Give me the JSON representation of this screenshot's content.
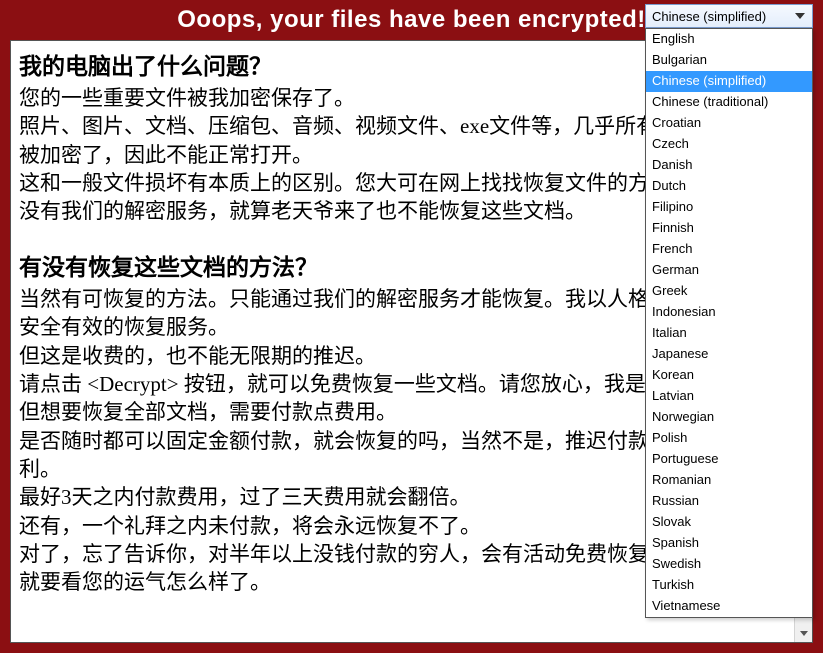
{
  "header": {
    "title": "Ooops, your files have been encrypted!"
  },
  "lang": {
    "selected": "Chinese (simplified)",
    "options": [
      "English",
      "Bulgarian",
      "Chinese (simplified)",
      "Chinese (traditional)",
      "Croatian",
      "Czech",
      "Danish",
      "Dutch",
      "Filipino",
      "Finnish",
      "French",
      "German",
      "Greek",
      "Indonesian",
      "Italian",
      "Japanese",
      "Korean",
      "Latvian",
      "Norwegian",
      "Polish",
      "Portuguese",
      "Romanian",
      "Russian",
      "Slovak",
      "Spanish",
      "Swedish",
      "Turkish",
      "Vietnamese"
    ]
  },
  "body": {
    "h1": "我的电脑出了什么问题？",
    "p1": "您的一些重要文件被我加密保存了。",
    "p2": "照片、图片、文档、压缩包、音频、视频文件、exe文件等，几乎所有类型的文件都被加密了，因此不能正常打开。",
    "p3": "这和一般文件损坏有本质上的区别。您大可在网上找找恢复文件的方法，我敢保证，没有我们的解密服务，就算老天爷来了也不能恢复这些文档。",
    "h2": "有没有恢复这些文档的方法？",
    "p4": "当然有可恢复的方法。只能通过我们的解密服务才能恢复。我以人格担保，能够提供安全有效的恢复服务。",
    "p5": "但这是收费的，也不能无限期的推迟。",
    "p6": "请点击 <Decrypt> 按钮，就可以免费恢复一些文档。请您放心，我是绝不会骗你的。",
    "p7": "但想要恢复全部文档，需要付款点费用。",
    "p8": "是否随时都可以固定金额付款，就会恢复的吗，当然不是，推迟付款时间越长对你不利。",
    "p9": "最好3天之内付款费用，过了三天费用就会翻倍。",
    "p10": "还有，一个礼拜之内未付款，将会永远恢复不了。",
    "p11": "对了，忘了告诉你，对半年以上没钱付款的穷人，会有活动免费恢复，能否轮到你，就要看您的运气怎么样了。"
  }
}
